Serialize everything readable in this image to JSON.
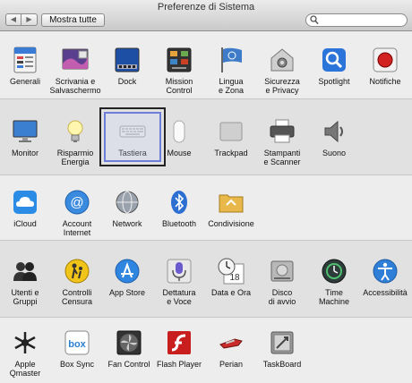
{
  "window": {
    "title": "Preferenze di Sistema"
  },
  "toolbar": {
    "back_symbol": "◀",
    "forward_symbol": "▶",
    "show_all_label": "Mostra tutte",
    "search_placeholder": "",
    "search_value": ""
  },
  "sections": [
    {
      "items": [
        {
          "label": "Generali",
          "icon": "general-icon"
        },
        {
          "label": "Scrivania e\nSalvaschermo",
          "icon": "desktop-icon"
        },
        {
          "label": "Dock",
          "icon": "dock-icon"
        },
        {
          "label": "Mission\nControl",
          "icon": "mission-control-icon"
        },
        {
          "label": "Lingua\ne Zona",
          "icon": "language-flag-icon"
        },
        {
          "label": "Sicurezza\ne Privacy",
          "icon": "security-icon"
        },
        {
          "label": "Spotlight",
          "icon": "spotlight-icon"
        },
        {
          "label": "Notifiche",
          "icon": "notifications-icon"
        }
      ]
    },
    {
      "items": [
        {
          "label": "Monitor",
          "icon": "monitor-icon"
        },
        {
          "label": "Risparmio\nEnergia",
          "icon": "lightbulb-icon"
        },
        {
          "label": "Tastiera",
          "icon": "keyboard-icon",
          "selected": true
        },
        {
          "label": "Mouse",
          "icon": "mouse-icon"
        },
        {
          "label": "Trackpad",
          "icon": "trackpad-icon"
        },
        {
          "label": "Stampanti\ne Scanner",
          "icon": "printer-icon"
        },
        {
          "label": "Suono",
          "icon": "speaker-icon"
        }
      ]
    },
    {
      "items": [
        {
          "label": "iCloud",
          "icon": "icloud-icon"
        },
        {
          "label": "Account\nInternet",
          "icon": "at-icon"
        },
        {
          "label": "Network",
          "icon": "network-globe-icon"
        },
        {
          "label": "Bluetooth",
          "icon": "bluetooth-icon"
        },
        {
          "label": "Condivisione",
          "icon": "sharing-folder-icon"
        }
      ]
    },
    {
      "items": [
        {
          "label": "Utenti e\nGruppi",
          "icon": "users-icon"
        },
        {
          "label": "Controlli\nCensura",
          "icon": "parental-controls-icon"
        },
        {
          "label": "App Store",
          "icon": "app-store-icon"
        },
        {
          "label": "Dettatura\ne Voce",
          "icon": "microphone-icon"
        },
        {
          "label": "Data e Ora",
          "icon": "clock-calendar-icon"
        },
        {
          "label": "Disco\ndi avvio",
          "icon": "startup-disk-icon"
        },
        {
          "label": "Time\nMachine",
          "icon": "time-machine-icon"
        },
        {
          "label": "Accessibilità",
          "icon": "accessibility-icon"
        }
      ]
    },
    {
      "items": [
        {
          "label": "Apple\nQmaster",
          "icon": "qmaster-icon"
        },
        {
          "label": "Box Sync",
          "icon": "box-sync-icon"
        },
        {
          "label": "Fan Control",
          "icon": "fan-control-icon"
        },
        {
          "label": "Flash Player",
          "icon": "flash-player-icon"
        },
        {
          "label": "Perian",
          "icon": "perian-icon"
        },
        {
          "label": "TaskBoard",
          "icon": "taskboard-icon"
        }
      ]
    }
  ],
  "calendar_icon_day": "18",
  "box_icon_text": "box",
  "colors": {
    "selection_border": "#222222",
    "selection_inner": "#6d7fd8",
    "accent_blue": "#2b74d9",
    "notification_red": "#d22222"
  }
}
